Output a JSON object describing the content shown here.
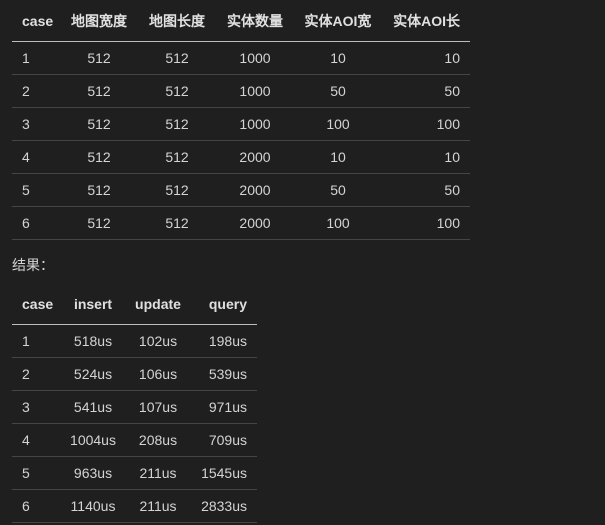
{
  "config_table": {
    "headers": [
      "case",
      "地图宽度",
      "地图长度",
      "实体数量",
      "实体AOI宽",
      "实体AOI长"
    ],
    "rows": [
      [
        "1",
        "512",
        "512",
        "1000",
        "10",
        "10"
      ],
      [
        "2",
        "512",
        "512",
        "1000",
        "50",
        "50"
      ],
      [
        "3",
        "512",
        "512",
        "1000",
        "100",
        "100"
      ],
      [
        "4",
        "512",
        "512",
        "2000",
        "10",
        "10"
      ],
      [
        "5",
        "512",
        "512",
        "2000",
        "50",
        "50"
      ],
      [
        "6",
        "512",
        "512",
        "2000",
        "100",
        "100"
      ]
    ]
  },
  "results_label": "结果：",
  "results_table": {
    "headers": [
      "case",
      "insert",
      "update",
      "query"
    ],
    "rows": [
      [
        "1",
        "518us",
        "102us",
        "198us"
      ],
      [
        "2",
        "524us",
        "106us",
        "539us"
      ],
      [
        "3",
        "541us",
        "107us",
        "971us"
      ],
      [
        "4",
        "1004us",
        "208us",
        "709us"
      ],
      [
        "5",
        "963us",
        "211us",
        "1545us"
      ],
      [
        "6",
        "1140us",
        "211us",
        "2833us"
      ]
    ]
  }
}
